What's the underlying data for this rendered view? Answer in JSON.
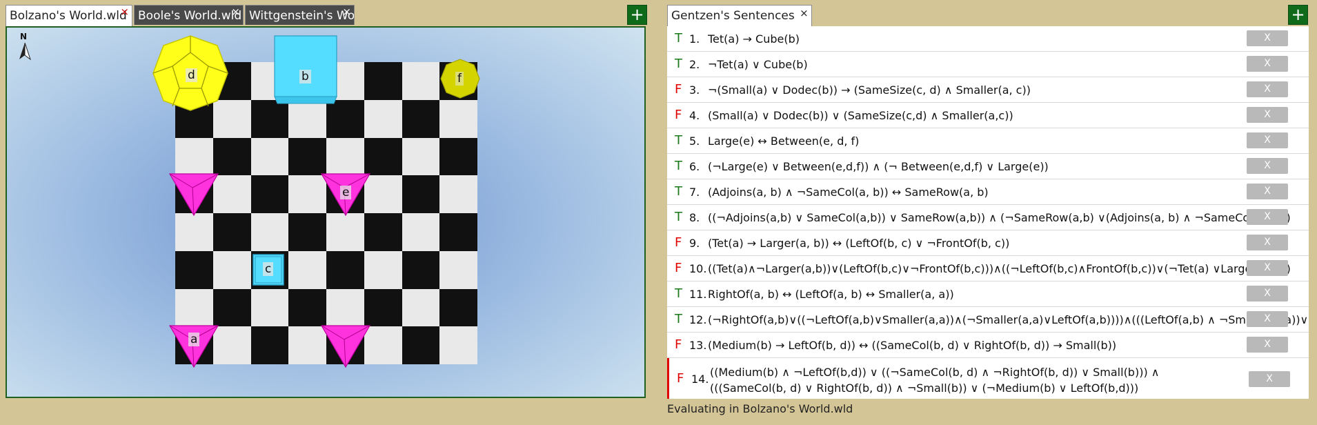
{
  "world_tabs": [
    {
      "label": "Bolzano's World.wld",
      "close": "×"
    },
    {
      "label": "Boole's World.wld",
      "close": "×"
    },
    {
      "label": "Wittgenstein's World.wld",
      "close": "×"
    }
  ],
  "plus_label": "+",
  "compass": {
    "label": "N"
  },
  "blocks": [
    {
      "shape": "dodecahedron",
      "size": "large",
      "label": "d",
      "color": "#ffff1a"
    },
    {
      "shape": "cube",
      "size": "large",
      "label": "b",
      "color": "#55ddff"
    },
    {
      "shape": "dodecahedron",
      "size": "small",
      "label": "f",
      "color": "#d4d400"
    },
    {
      "shape": "tetrahedron",
      "size": "medium",
      "label": "",
      "color": "#ff33dd"
    },
    {
      "shape": "tetrahedron",
      "size": "medium",
      "label": "e",
      "color": "#ff33dd"
    },
    {
      "shape": "cube",
      "size": "small",
      "label": "c",
      "color": "#55ddff"
    },
    {
      "shape": "tetrahedron",
      "size": "medium",
      "label": "a",
      "color": "#ff33dd"
    },
    {
      "shape": "tetrahedron",
      "size": "medium",
      "label": "",
      "color": "#ff33dd"
    }
  ],
  "sentences_tab": {
    "label": "Gentzen's Sentences",
    "close": "×"
  },
  "sentences": [
    {
      "tv": "T",
      "num": "1.",
      "text": "Tet(a) → Cube(b)"
    },
    {
      "tv": "T",
      "num": "2.",
      "text": "¬Tet(a) ∨ Cube(b)"
    },
    {
      "tv": "F",
      "num": "3.",
      "text": " ¬(Small(a) ∨ Dodec(b)) → (SameSize(c, d) ∧ Smaller(a, c))"
    },
    {
      "tv": "F",
      "num": "4.",
      "text": "(Small(a) ∨ Dodec(b)) ∨ (SameSize(c,d) ∧ Smaller(a,c))"
    },
    {
      "tv": "T",
      "num": "5.",
      "text": "Large(e) ↔ Between(e, d, f)"
    },
    {
      "tv": "T",
      "num": "6.",
      "text": "(¬Large(e) ∨ Between(e,d,f)) ∧ (¬ Between(e,d,f) ∨ Large(e))"
    },
    {
      "tv": "T",
      "num": "7.",
      "text": "(Adjoins(a, b) ∧ ¬SameCol(a, b)) ↔ SameRow(a, b)"
    },
    {
      "tv": "T",
      "num": "8.",
      "text": "((¬Adjoins(a,b) ∨ SameCol(a,b)) ∨ SameRow(a,b)) ∧ (¬SameRow(a,b) ∨(Adjoins(a, b) ∧ ¬SameCol(a, b)))"
    },
    {
      "tv": "F",
      "num": "9.",
      "text": "(Tet(a) → Larger(a, b)) ↔ (LeftOf(b, c) ∨ ¬FrontOf(b, c))"
    },
    {
      "tv": "F",
      "num": "10.",
      "text": "((Tet(a)∧¬Larger(a,b))∨(LeftOf(b,c)∨¬FrontOf(b,c)))∧((¬LeftOf(b,c)∧FrontOf(b,c))∨(¬Tet(a) ∨Larger(a,b)))"
    },
    {
      "tv": "T",
      "num": "11.",
      "text": "RightOf(a, b) ↔ (LeftOf(a, b) ↔ Smaller(a, a))"
    },
    {
      "tv": "T",
      "num": "12.",
      "text": "(¬RightOf(a,b)∨((¬LeftOf(a,b)∨Smaller(a,a))∧(¬Smaller(a,a)∨LeftOf(a,b))))∧(((LeftOf(a,b) ∧ ¬Smaller(a,a))∨"
    },
    {
      "tv": "F",
      "num": "13.",
      "text": "(Medium(b) → LeftOf(b, d)) ↔ ((SameCol(b, d) ∨ RightOf(b, d)) → Small(b))"
    },
    {
      "tv": "F",
      "num": "14.",
      "text": "((Medium(b) ∧ ¬LeftOf(b,d)) ∨ ((¬SameCol(b, d) ∧ ¬RightOf(b, d)) ∨ Small(b))) ∧",
      "text2": "(((SameCol(b, d) ∨ RightOf(b, d)) ∧ ¬Small(b)) ∨ (¬Medium(b) ∨ LeftOf(b,d)))"
    }
  ],
  "delete_label": "X",
  "status": "Evaluating in Bolzano's World.wld"
}
